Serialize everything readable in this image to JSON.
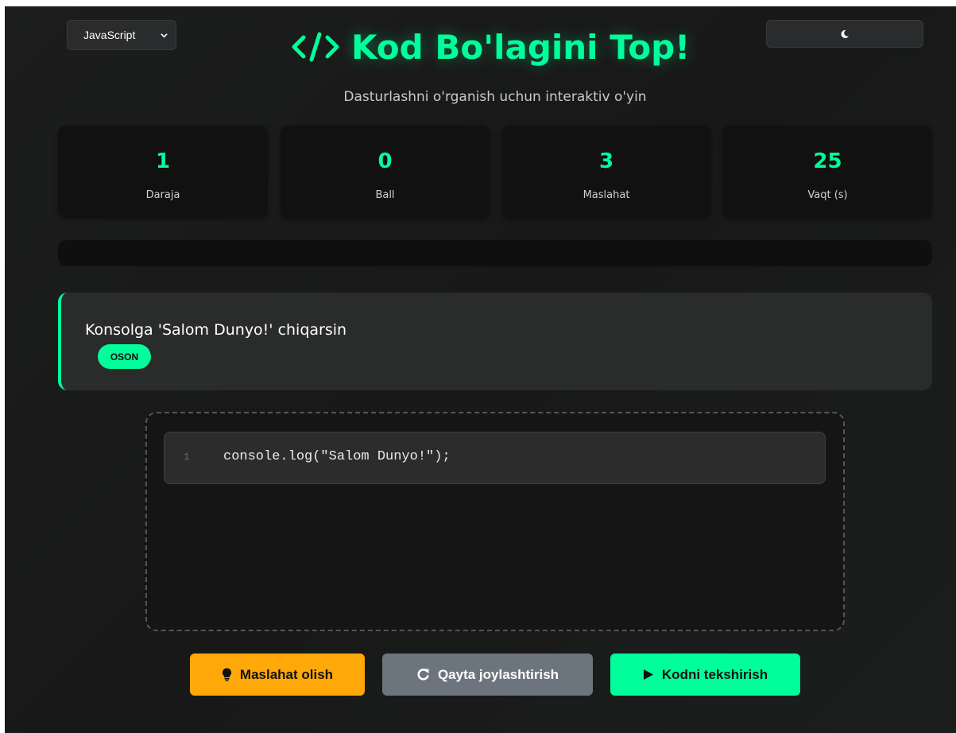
{
  "header": {
    "language_select": {
      "value": "JavaScript"
    },
    "title": "Kod Bo'lagini Top!",
    "title_icon": "code-icon",
    "theme_toggle_icon": "moon-icon",
    "subtitle": "Dasturlashni o'rganish uchun interaktiv o'yin"
  },
  "stats": [
    {
      "value": "1",
      "label": "Daraja"
    },
    {
      "value": "0",
      "label": "Ball"
    },
    {
      "value": "3",
      "label": "Maslahat"
    },
    {
      "value": "25",
      "label": "Vaqt (s)"
    }
  ],
  "progress": {
    "fraction": 0
  },
  "task": {
    "text": "Konsolga 'Salom Dunyo!' chiqarsin",
    "difficulty": "OSON"
  },
  "code_lines": [
    {
      "number": "1",
      "code": "console.log(\"Salom Dunyo!\");"
    }
  ],
  "buttons": {
    "hint": {
      "label": "Maslahat olish",
      "icon": "lightbulb-icon"
    },
    "reset": {
      "label": "Qayta joylashtirish",
      "icon": "redo-icon"
    },
    "check": {
      "label": "Kodni tekshirish",
      "icon": "play-icon"
    }
  },
  "colors": {
    "accent": "#00ff9a",
    "warning": "#ffa80a",
    "secondary": "#6c757d",
    "background": "#1a1b1b"
  }
}
